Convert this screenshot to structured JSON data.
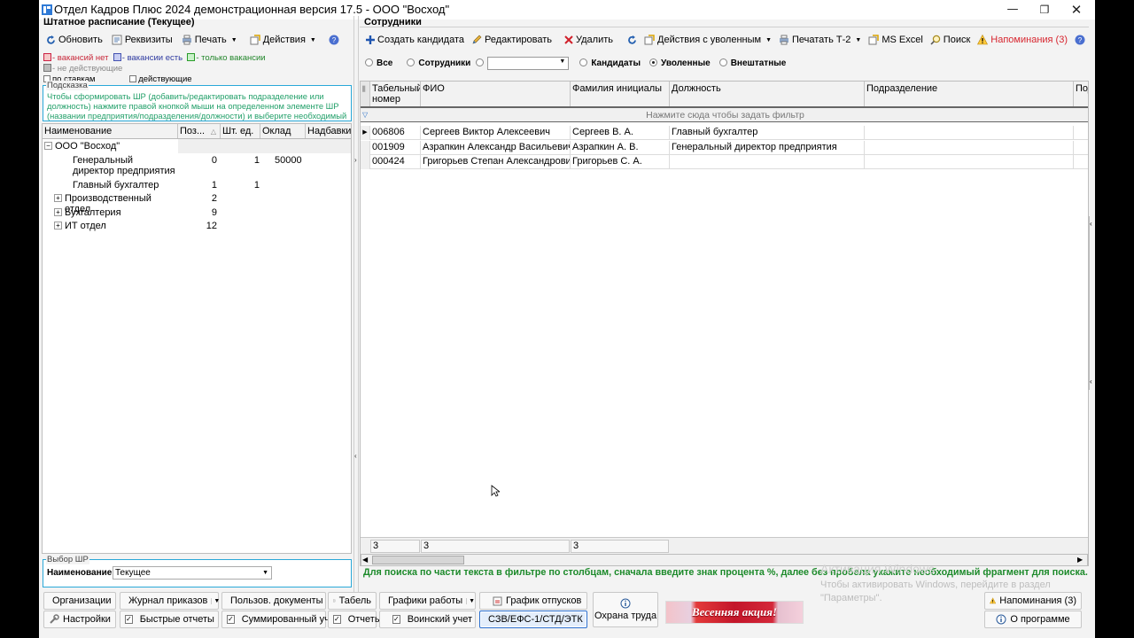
{
  "window": {
    "title": "Отдел Кадров Плюс 2024 демонстрационная версия 17.5 - ООО \"Восход\""
  },
  "left": {
    "title": "Штатное расписание (Текущее)",
    "toolbar": {
      "refresh": "Обновить",
      "details": "Реквизиты",
      "print": "Печать",
      "actions": "Действия"
    },
    "legend": {
      "no_vacancy": "- вакансий нет",
      "has_vacancy": "- вакансии есть",
      "only_vacancy": "- только вакансии",
      "inactive": "- не действующие",
      "by_rates": "по ставкам",
      "active": "действующие"
    },
    "hint": {
      "label": "Подсказка",
      "text": "Чтобы сформировать ШР (добавить/редактировать подразделение или должность) нажмите правой кнопкой мыши на определенном элементе ШР (названии предприятия/подразделения/должности) и выберите необходимый пункт из меню."
    },
    "tree": {
      "columns": [
        "Наименование",
        "Поз...",
        "Шт. ед.",
        "Оклад",
        "Надбавки"
      ],
      "rows": [
        {
          "name": "ООО \"Восход\"",
          "pos": "",
          "units": "",
          "salary": "",
          "expand": "−"
        },
        {
          "name": "Генеральный директор предприятия",
          "pos": "0",
          "units": "1",
          "salary": "50000",
          "expand": ""
        },
        {
          "name": "Главный бухгалтер",
          "pos": "1",
          "units": "1",
          "salary": "",
          "expand": ""
        },
        {
          "name": "Производственный отдел",
          "pos": "2",
          "units": "",
          "salary": "",
          "expand": "+"
        },
        {
          "name": "Бухгалтерия",
          "pos": "9",
          "units": "",
          "salary": "",
          "expand": "+"
        },
        {
          "name": "ИТ отдел",
          "pos": "12",
          "units": "",
          "salary": "",
          "expand": "+"
        }
      ]
    },
    "choose": {
      "group_label": "Выбор ШР",
      "field_label": "Наименование",
      "value": "Текущее"
    }
  },
  "right": {
    "title": "Сотрудники",
    "toolbar": {
      "create": "Создать кандидата",
      "edit": "Редактировать",
      "delete": "Удалить",
      "fired_actions": "Действия с уволенным",
      "print_t2": "Печатать Т-2",
      "excel": "MS Excel",
      "search": "Поиск",
      "reminders": "Напоминания (3)"
    },
    "filters": {
      "all": "Все",
      "employees": "Сотрудники",
      "candidates": "Кандидаты",
      "fired": "Уволенные",
      "external": "Внештатные",
      "selected": "fired"
    },
    "grid": {
      "columns": [
        "Табельный номер",
        "ФИО",
        "Фамилия инициалы",
        "Должность",
        "Подразделение",
        "Под"
      ],
      "filter_hint": "Нажмите  сюда чтобы задать фильтр",
      "rows": [
        {
          "num": "006806",
          "fio": "Сергеев Виктор Алексеевич",
          "short": "Сергеев В. А.",
          "position": "Главный бухгалтер",
          "dept": ""
        },
        {
          "num": "001909",
          "fio": "Азрапкин Александр Васильевич",
          "short": "Азрапкин А. В.",
          "position": "Генеральный директор предприятия",
          "dept": ""
        },
        {
          "num": "000424",
          "fio": "Григорьев Степан Александрович",
          "short": "Григорьев С. А.",
          "position": "",
          "dept": ""
        }
      ],
      "footer": [
        "3",
        "3",
        "3"
      ]
    },
    "search_hint": "Для поиска по части текста в фильтре по столбцам, сначала введите знак процента %, далее без пробела укажите необходимый фрагмент для поиска."
  },
  "watermark": {
    "line1": "Активация Windows",
    "line2": "Чтобы активировать Windows, перейдите в раздел",
    "line3": "\"Параметры\"."
  },
  "bottom": {
    "orgs": "Организации",
    "orders": "Журнал приказов",
    "user_docs": "Пользов. документы",
    "timesheet": "Табель",
    "schedules": "Графики работы",
    "vacations": "График отпусков",
    "labor_safety": "Охрана труда",
    "promo": "Весенняя акция!",
    "reminders": "Напоминания (3)",
    "settings": "Настройки",
    "quick_reports": "Быстрые отчеты",
    "summary": "Суммированный учет",
    "reports": "Отчеты",
    "military": "Воинский учет",
    "szv": "СЗВ/ЕФС-1/СТД/ЭТК",
    "about": "О программе"
  }
}
